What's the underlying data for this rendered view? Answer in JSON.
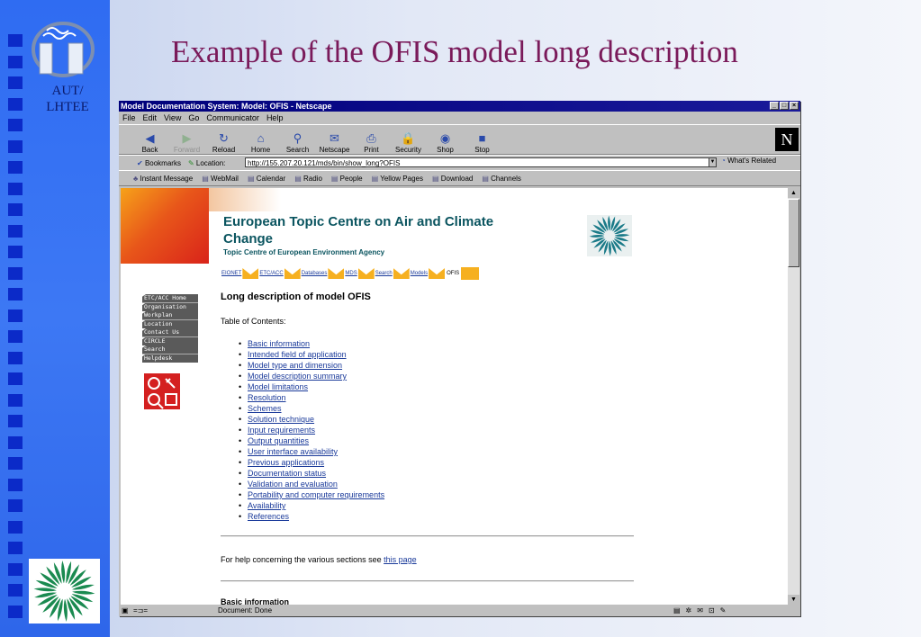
{
  "slide": {
    "title": "Example of the OFIS model long description",
    "org_label_line1": "AUT/",
    "org_label_line2": "LHTEE"
  },
  "browser": {
    "title": "Model Documentation System: Model: OFIS - Netscape",
    "menu": [
      "File",
      "Edit",
      "View",
      "Go",
      "Communicator",
      "Help"
    ],
    "nav_buttons": [
      {
        "label": "Back",
        "icon": "back-arrow-icon",
        "glyph": "◀",
        "disabled": false
      },
      {
        "label": "Forward",
        "icon": "forward-arrow-icon",
        "glyph": "▶",
        "disabled": true
      },
      {
        "label": "Reload",
        "icon": "reload-icon",
        "glyph": "↻",
        "disabled": false
      },
      {
        "label": "Home",
        "icon": "home-icon",
        "glyph": "⌂",
        "disabled": false
      },
      {
        "label": "Search",
        "icon": "search-icon",
        "glyph": "⚲",
        "disabled": false
      },
      {
        "label": "Netscape",
        "icon": "netscape-icon",
        "glyph": "✉",
        "disabled": false
      },
      {
        "label": "Print",
        "icon": "print-icon",
        "glyph": "⎙",
        "disabled": false
      },
      {
        "label": "Security",
        "icon": "security-lock-icon",
        "glyph": "🔒",
        "disabled": false
      },
      {
        "label": "Shop",
        "icon": "shop-icon",
        "glyph": "◉",
        "disabled": false
      },
      {
        "label": "Stop",
        "icon": "stop-icon",
        "glyph": "■",
        "disabled": false
      }
    ],
    "bookmarks_label": "Bookmarks",
    "location_label": "Location:",
    "url": "http://155.207.20.121/mds/bin/show_long?OFIS",
    "whats_related": "What's Related",
    "personal_bar": [
      "Instant Message",
      "WebMail",
      "Calendar",
      "Radio",
      "People",
      "Yellow Pages",
      "Download",
      "Channels"
    ],
    "status": "Document: Done"
  },
  "page": {
    "site_title": "European Topic Centre on Air and Climate Change",
    "site_subtitle": "Topic Centre of European Environment Agency",
    "breadcrumbs": [
      "EIONET",
      "ETC/ACC",
      "Databases",
      "MDS",
      "Search",
      "Models"
    ],
    "breadcrumb_current": "OFIS",
    "left_menu": [
      "ETC/ACC Home",
      "Organisation",
      "Workplan",
      "Location",
      "Contact Us",
      "CIRCLE",
      "Search",
      "Helpdesk"
    ],
    "heading": "Long description of model OFIS",
    "toc_label": "Table of Contents:",
    "toc": [
      "Basic information",
      "Intended field of application",
      "Model type and dimension",
      "Model description summary",
      "Model limitations",
      "Resolution",
      "Schemes",
      "Solution technique",
      "Input requirements",
      "Output quantities",
      "User interface availability",
      "Previous applications",
      "Documentation status",
      "Validation and evaluation",
      "Portability and computer requirements",
      "Availability",
      "References"
    ],
    "help_text": "For help concerning the various sections see",
    "help_link": "this page",
    "next_section": "Basic information"
  }
}
